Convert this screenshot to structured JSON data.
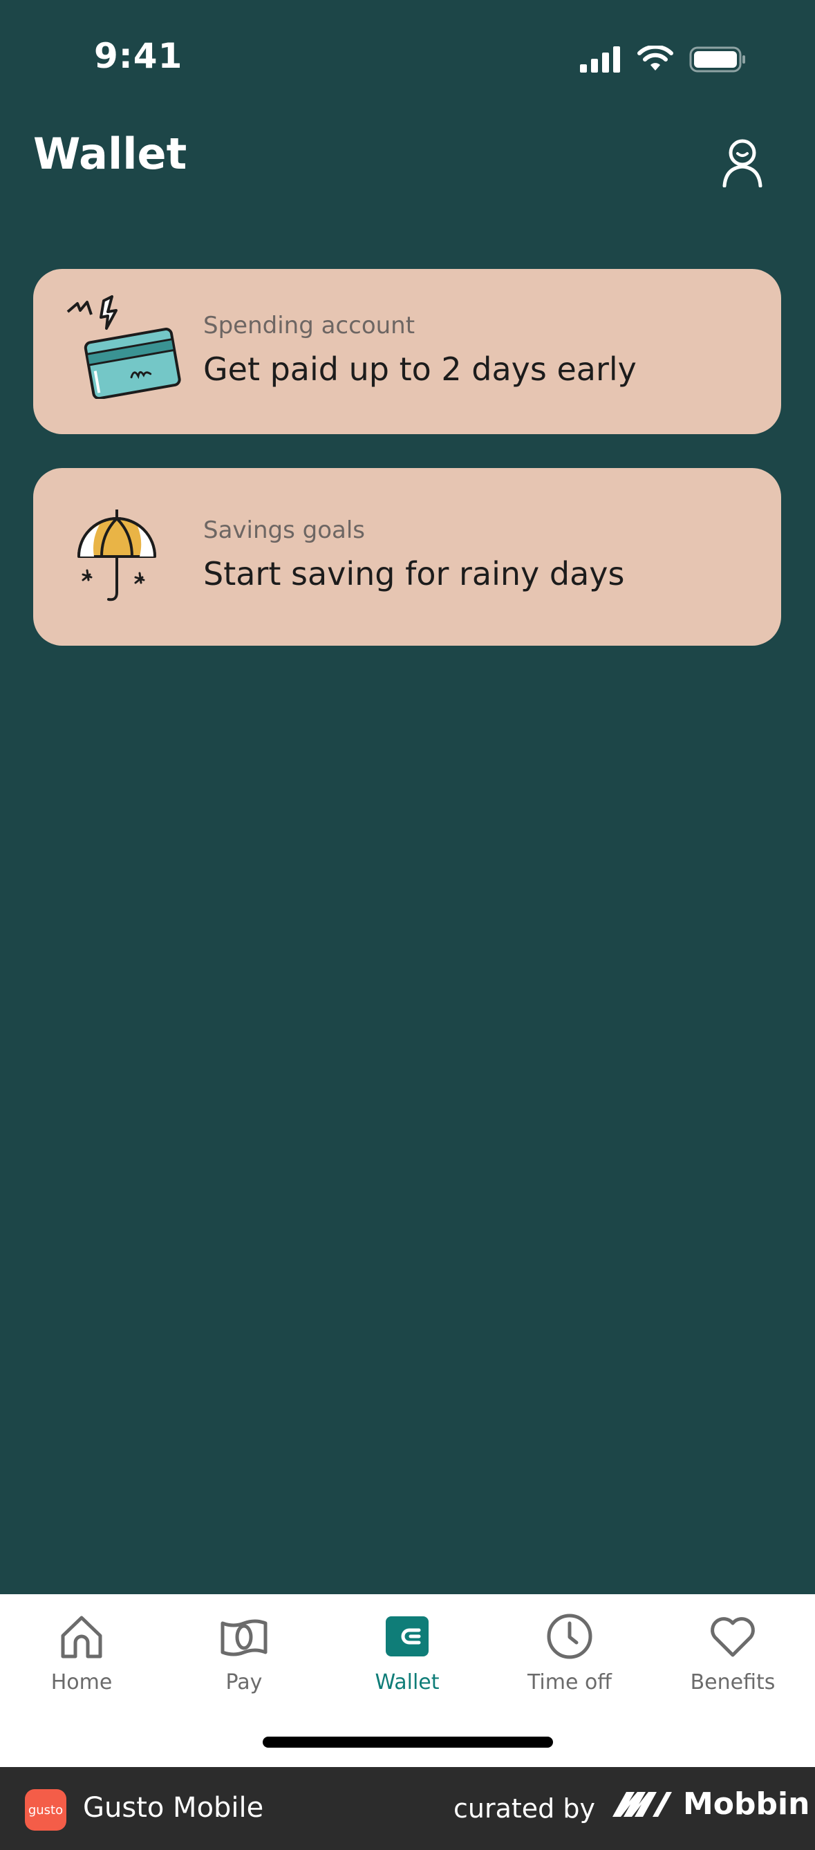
{
  "status_bar": {
    "time": "9:41"
  },
  "header": {
    "title": "Wallet"
  },
  "cards": [
    {
      "kicker": "Spending account",
      "title": "Get paid up to 2 days early",
      "icon": "credit-card-lightning-icon"
    },
    {
      "kicker": "Savings goals",
      "title": "Start saving for rainy days",
      "icon": "umbrella-icon"
    }
  ],
  "tabbar": {
    "tabs": [
      {
        "label": "Home",
        "icon": "home-icon"
      },
      {
        "label": "Pay",
        "icon": "money-icon"
      },
      {
        "label": "Wallet",
        "icon": "wallet-icon",
        "active": true
      },
      {
        "label": "Time off",
        "icon": "clock-icon"
      },
      {
        "label": "Benefits",
        "icon": "heart-icon"
      }
    ]
  },
  "footer": {
    "logo_text": "gusto",
    "app_name": "Gusto Mobile",
    "curated_by": "curated by",
    "brand": "Mobbin"
  },
  "colors": {
    "background": "#1d4648",
    "card": "#e6c5b2",
    "active_tab": "#0f7d78",
    "gusto_brand": "#f45d48"
  }
}
